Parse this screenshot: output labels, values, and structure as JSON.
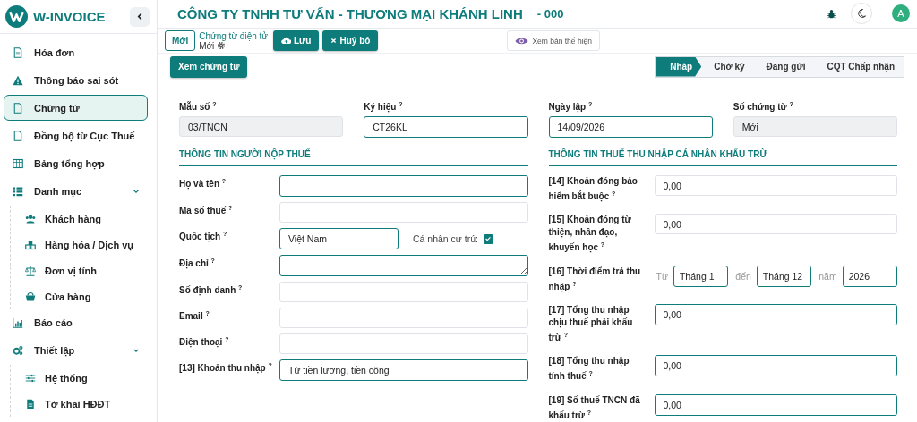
{
  "app": {
    "logo_text": "W-INVOICE"
  },
  "sidebar": {
    "items": [
      {
        "label": "Hóa đơn",
        "selected": false
      },
      {
        "label": "Thông báo sai sót",
        "selected": false
      },
      {
        "label": "Chứng từ",
        "selected": true
      },
      {
        "label": "Đồng bộ từ Cục Thuế",
        "selected": false
      },
      {
        "label": "Bảng tổng hợp",
        "selected": false
      },
      {
        "label": "Danh mục",
        "selected": false,
        "expanded": true,
        "children": [
          {
            "label": "Khách hàng",
            "selected": false
          },
          {
            "label": "Hàng hóa / Dịch vụ",
            "selected": false
          },
          {
            "label": "Đơn vị tính",
            "selected": false
          },
          {
            "label": "Cửa hàng",
            "selected": false
          }
        ]
      },
      {
        "label": "Báo cáo",
        "selected": false
      },
      {
        "label": "Thiết lập",
        "selected": false,
        "expanded": true,
        "children": [
          {
            "label": "Hệ thống",
            "selected": false
          },
          {
            "label": "Tờ khai HĐĐT",
            "selected": false
          }
        ]
      }
    ]
  },
  "header": {
    "company": "CÔNG TY TNHH TƯ VẤN - THƯƠNG MẠI KHÁNH LINH",
    "code": "- 000",
    "avatar": "A"
  },
  "toolbar": {
    "status_badge": "Mới",
    "doc_type": "Chứng từ điện tử",
    "doc_state": "Mới",
    "buttons": [
      {
        "label": "Lưu"
      },
      {
        "label": "Huỷ bỏ"
      }
    ],
    "preview": "Xem bản thể hiện",
    "view_button": "Xem chứng từ"
  },
  "steps": [
    {
      "label": "Nháp",
      "selected": true
    },
    {
      "label": "Chờ ký",
      "selected": false
    },
    {
      "label": "Đang gửi",
      "selected": false
    },
    {
      "label": "CQT Chấp nhận",
      "selected": false
    }
  ],
  "top_fields": [
    {
      "label": "Mẫu số $^{?}$",
      "value": "03/TNCN",
      "readonly": true,
      "required": false
    },
    {
      "label": "Ký hiệu $^{?}$",
      "value": "CT26KL",
      "readonly": false,
      "required": true
    },
    {
      "label": "Ngày lập $^{?}$",
      "value": "14/09/2026",
      "readonly": false,
      "required": true
    },
    {
      "label": "Số chứng từ $^{?}$",
      "value": "Mới",
      "readonly": true,
      "required": false
    }
  ],
  "taxpayer": {
    "title": "THÔNG TIN NGƯỜI NỘP THUẾ",
    "fields": [
      {
        "kind": "text",
        "label": "Họ và tên $^{?}$",
        "required": true
      },
      {
        "kind": "text",
        "label": "Mã số thuế $^{?}$",
        "required": false
      },
      {
        "kind": "nationality",
        "label": "Quốc tịch $^{?}$",
        "value": "Việt Nam",
        "required": true,
        "resident_label": "Cá nhân cư trú:",
        "resident_checked": true
      },
      {
        "kind": "textarea",
        "label": "Địa chỉ $^{?}$",
        "required": true
      },
      {
        "kind": "text",
        "label": "Số định danh $^{?}$",
        "required": false
      },
      {
        "kind": "text",
        "label": "Email $^{?}$",
        "required": false
      },
      {
        "kind": "text",
        "label": "Điện thoại $^{?}$",
        "required": false
      },
      {
        "kind": "text",
        "label": "[13] Khoản thu nhập $^{?}$",
        "value": "Từ tiền lương, tiền công",
        "required": true
      }
    ]
  },
  "income_tax": {
    "title": "THÔNG TIN THUẾ THU NHẬP CÁ NHÂN KHẤU TRỪ",
    "fields": [
      {
        "kind": "text",
        "label": "[14] Khoản đóng bảo hiểm bắt buộc $^{?}$",
        "value": "0,00",
        "required": false
      },
      {
        "kind": "text",
        "label": "[15] Khoản đóng từ thiện, nhân đạo, khuyến học $^{?}$",
        "value": "0,00",
        "required": false
      },
      {
        "kind": "period",
        "label": "[16] Thời điểm trả thu nhập $^{?}$",
        "from_label": "Từ",
        "from": "Tháng 1",
        "to_label": "đến",
        "to": "Tháng 12",
        "year_label": "năm",
        "year": "2026",
        "required": true
      },
      {
        "kind": "text",
        "label": "[17] Tổng thu nhập chịu thuế phải khấu trừ $^{?}$",
        "value": "0,00",
        "required": true
      },
      {
        "kind": "text",
        "label": "[18] Tổng thu nhập tính thuế $^{?}$",
        "value": "0,00",
        "required": true
      },
      {
        "kind": "text",
        "label": "[19] Số thuế TNCN đã khấu trừ $^{?}$",
        "value": "0,00",
        "required": true
      }
    ]
  }
}
